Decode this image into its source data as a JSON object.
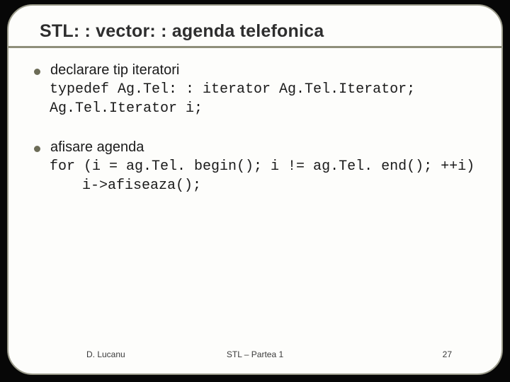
{
  "title": "STL: : vector: : agenda telefonica",
  "blocks": [
    {
      "bullet": "declarare tip iteratori",
      "code": [
        "typedef Ag.Tel: : iterator Ag.Tel.Iterator;",
        "Ag.Tel.Iterator i;"
      ]
    },
    {
      "bullet": "afisare agenda",
      "code": [
        "for (i = ag.Tel. begin(); i != ag.Tel. end(); ++i)"
      ],
      "code_indent": [
        "i->afiseaza();"
      ]
    }
  ],
  "footer": {
    "left": "D. Lucanu",
    "center": "STL – Partea 1",
    "right": "27"
  }
}
